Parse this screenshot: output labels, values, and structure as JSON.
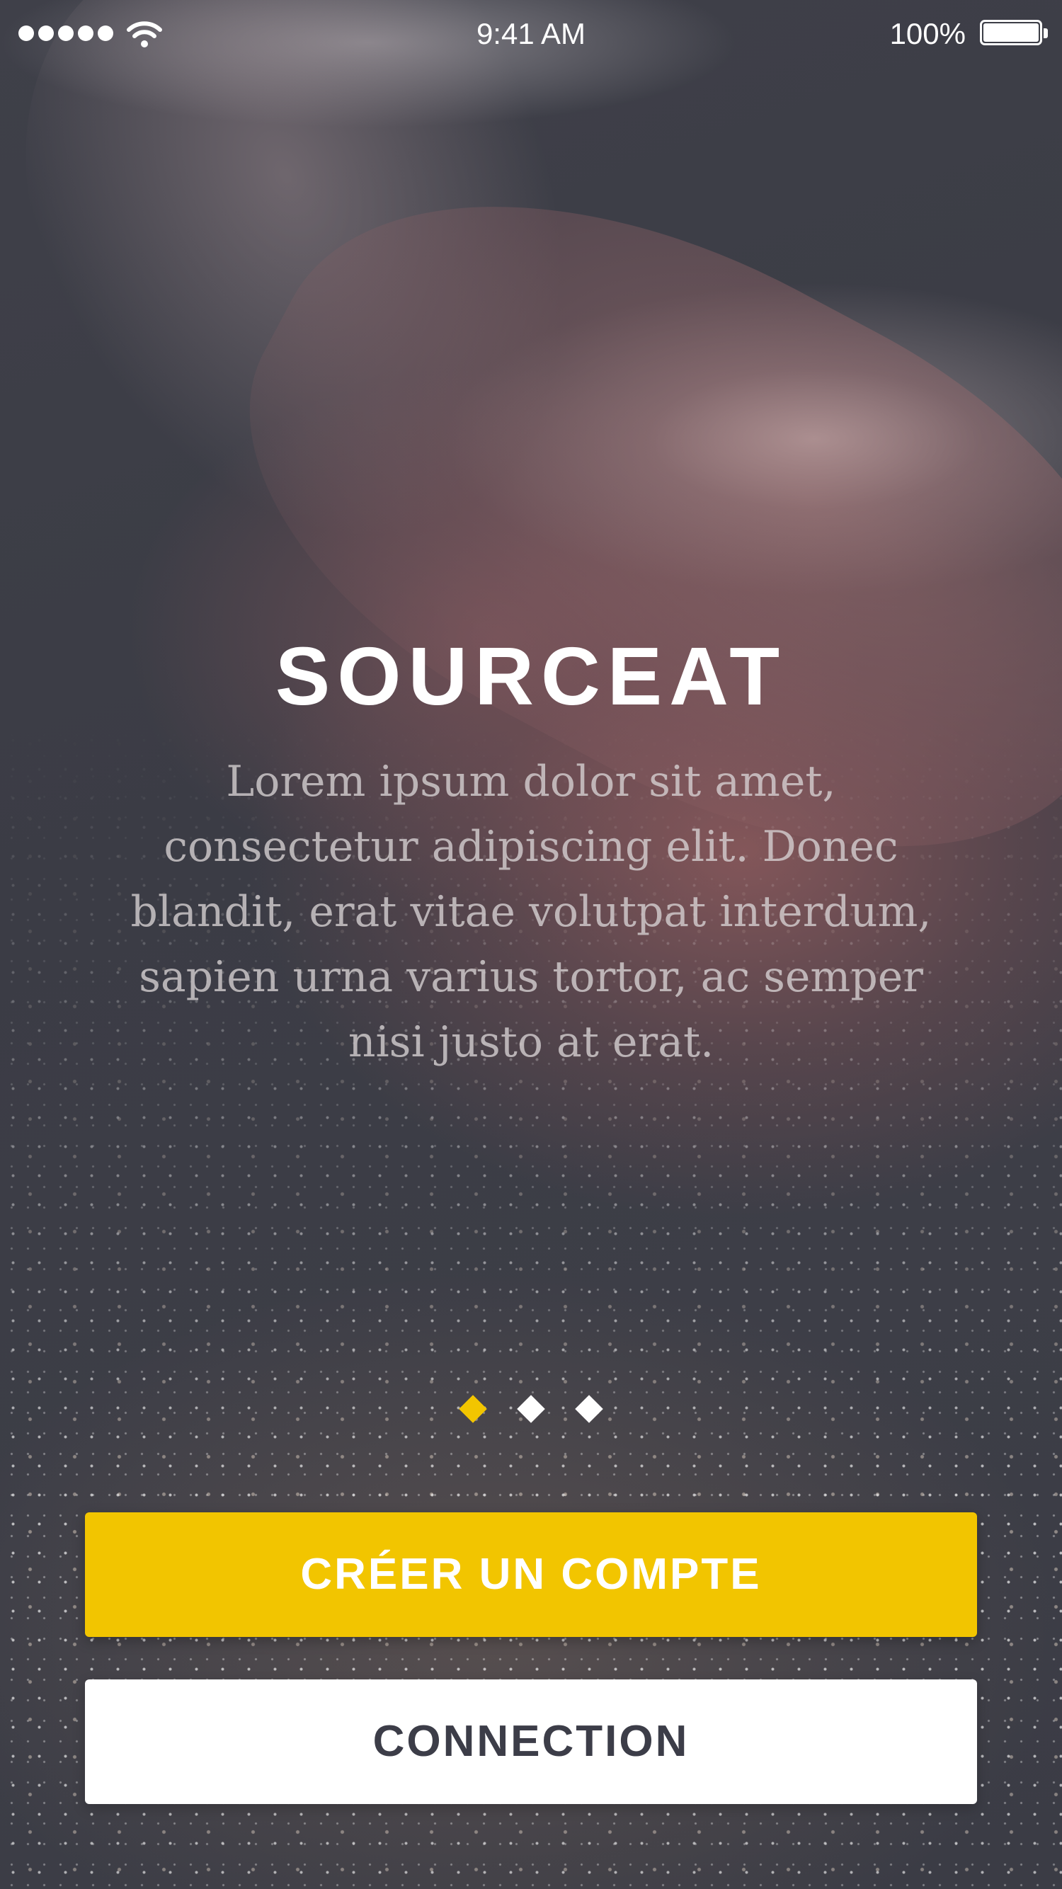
{
  "status_bar": {
    "time": "9:41 AM",
    "battery_percent": "100%",
    "battery_level": 1.0,
    "signal_dots": 5,
    "wifi_icon": "wifi-icon"
  },
  "main": {
    "title": "SOURCEAT",
    "description": "Lorem ipsum dolor sit amet, consectetur adipiscing elit. Donec blandit, erat vitae volutpat interdum, sapien urna varius tortor, ac semper nisi justo at erat."
  },
  "pagination": {
    "count": 3,
    "active_index": 0
  },
  "actions": {
    "create_account_label": "CRÉER UN COMPTE",
    "connection_label": "CONNECTION"
  },
  "colors": {
    "accent": "#f2c500",
    "background": "#3d3e47",
    "secondary_text": "#3c3d48"
  }
}
